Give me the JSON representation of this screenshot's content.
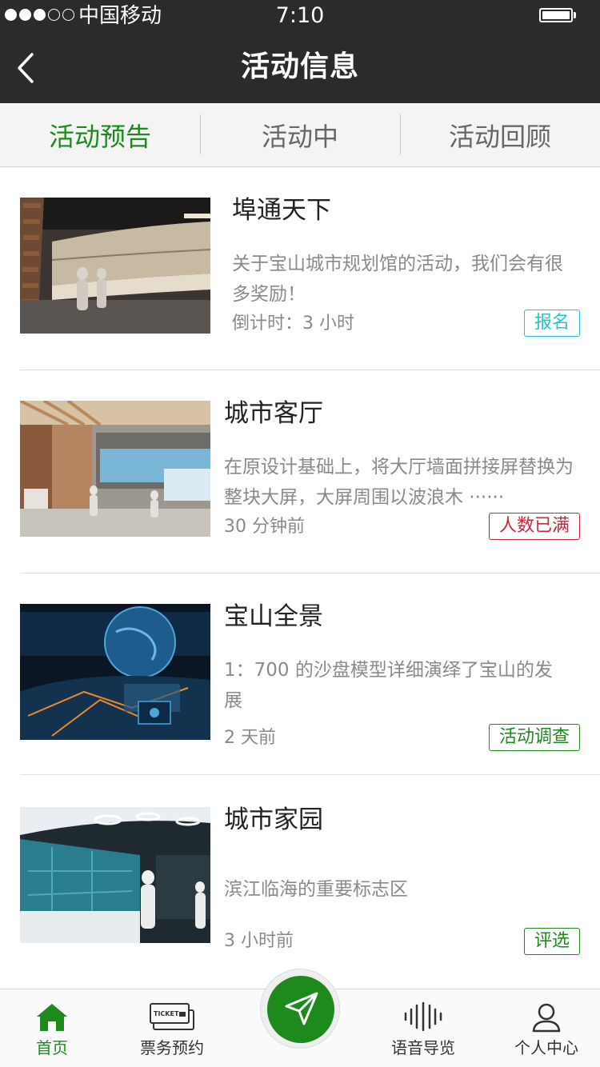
{
  "status_bar": {
    "carrier": "中国移动",
    "time": "7:10",
    "signal_strength": 3,
    "signal_max": 5
  },
  "nav": {
    "title": "活动信息",
    "back_icon": "chevron-left-icon"
  },
  "tabs": [
    {
      "label": "活动预告",
      "active": true
    },
    {
      "label": "活动中",
      "active": false
    },
    {
      "label": "活动回顾",
      "active": false
    }
  ],
  "activities": [
    {
      "title": "埠通天下",
      "description": "关于宝山城市规划馆的活动，我们会有很多奖励！",
      "time": "倒计时：3 小时",
      "badge": "报名",
      "badge_color": "#27c1cf"
    },
    {
      "title": "城市客厅",
      "description": "在原设计基础上，将大厅墙面拼接屏替换为整块大屏，大屏周围以波浪木 ······",
      "time": "30 分钟前",
      "badge": "人数已满",
      "badge_color": "#c9263c"
    },
    {
      "title": "宝山全景",
      "description": "1：700 的沙盘模型详细演绎了宝山的发展",
      "time": "2 天前",
      "badge": "活动调查",
      "badge_color": "#1e8a1e"
    },
    {
      "title": "城市家园",
      "description": "滨江临海的重要标志区",
      "time": "3 小时前",
      "badge": "评选",
      "badge_color": "#1e8a1e"
    }
  ],
  "tab_bar": {
    "items": [
      {
        "label": "首页",
        "icon": "home-icon",
        "active": true
      },
      {
        "label": "票务预约",
        "icon": "ticket-icon",
        "active": false
      },
      {
        "label": "语音导览",
        "icon": "audio-wave-icon",
        "active": false
      },
      {
        "label": "个人中心",
        "icon": "user-icon",
        "active": false
      }
    ],
    "center_icon": "send-arrow-icon",
    "ticket_icon_text": "TICKET"
  },
  "colors": {
    "accent": "#1e8a1e",
    "header_bg": "#2b2b2b",
    "tab_bg": "#f4f4f4"
  }
}
